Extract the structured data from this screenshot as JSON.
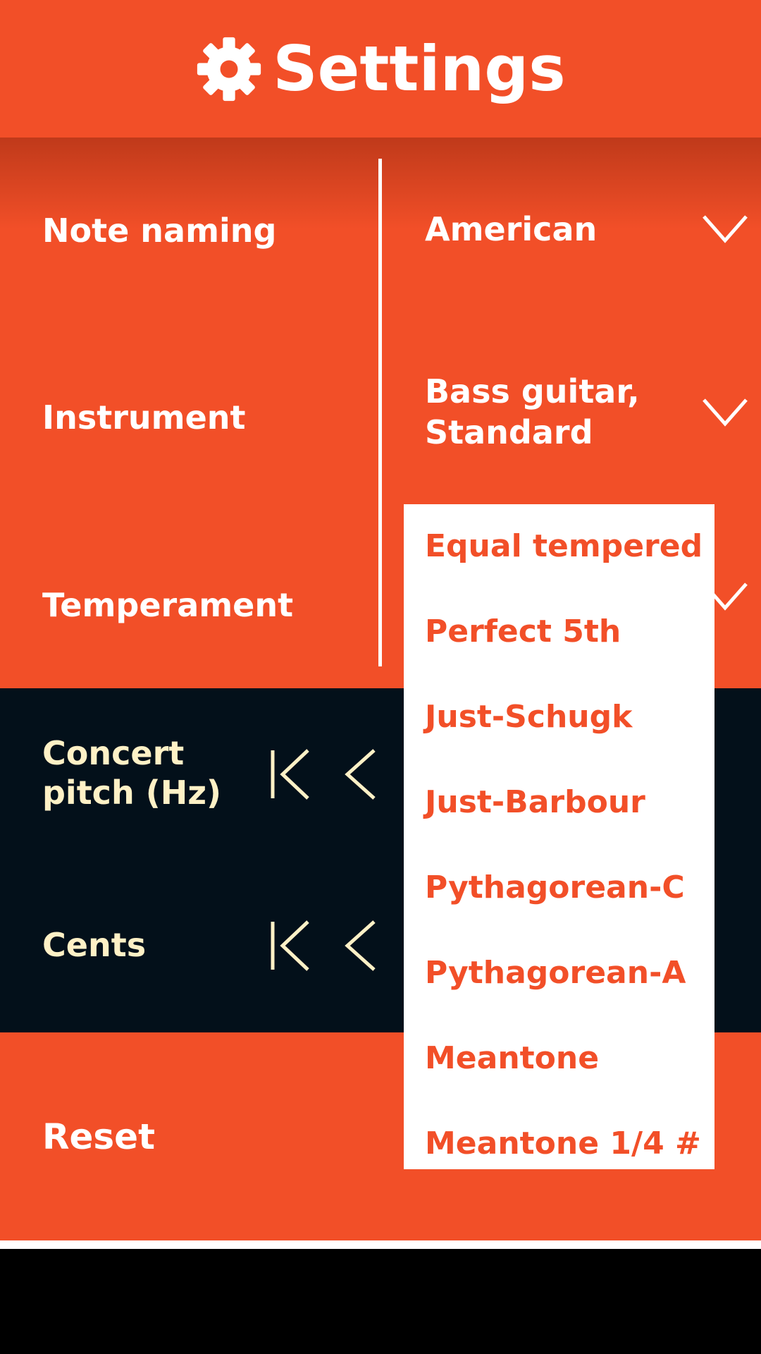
{
  "header": {
    "title": "Settings",
    "icon": "gear-icon"
  },
  "settings": {
    "note_naming": {
      "label": "Note naming",
      "value": "American"
    },
    "instrument": {
      "label": "Instrument",
      "value_line1": "Bass guitar,",
      "value_line2": "Standard"
    },
    "temperament": {
      "label": "Temperament"
    }
  },
  "pitch": {
    "concert_line1": "Concert",
    "concert_line2": "pitch (Hz)",
    "cents_label": "Cents"
  },
  "reset_label": "Reset",
  "temperament_options": [
    "Equal tempered",
    "Perfect 5th",
    "Just-Schugk",
    "Just-Barbour",
    "Pythagorean-C",
    "Pythagorean-A",
    "Meantone",
    "Meantone 1/4 #"
  ],
  "colors": {
    "accent": "#F24F28",
    "dark": "#03101A",
    "cream": "#FFF1C6",
    "white": "#FFFFFF"
  }
}
